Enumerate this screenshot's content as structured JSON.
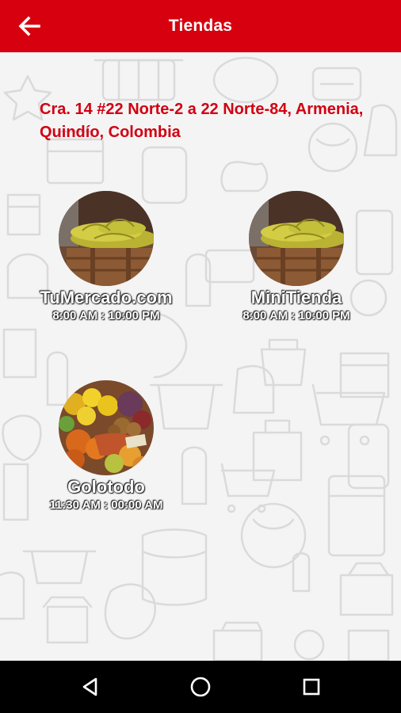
{
  "header": {
    "title": "Tiendas",
    "back_icon": "arrow-left-icon"
  },
  "address": "Cra. 14 #22 Norte-2 a 22 Norte-84, Armenia, Quindío, Colombia",
  "stores": [
    {
      "name": "TuMercado.com",
      "hours": "8:00 AM : 10:00 PM"
    },
    {
      "name": "MiniTienda",
      "hours": "8:00 AM : 10:00 PM"
    },
    {
      "name": "Golotodo",
      "hours": "11:30 AM : 00:00 AM"
    }
  ],
  "nav": {
    "back_icon": "triangle-back-icon",
    "home_icon": "circle-home-icon",
    "recents_icon": "square-recents-icon"
  },
  "colors": {
    "brand_red": "#d7000f",
    "address_red": "#d10012",
    "nav_black": "#000000"
  }
}
